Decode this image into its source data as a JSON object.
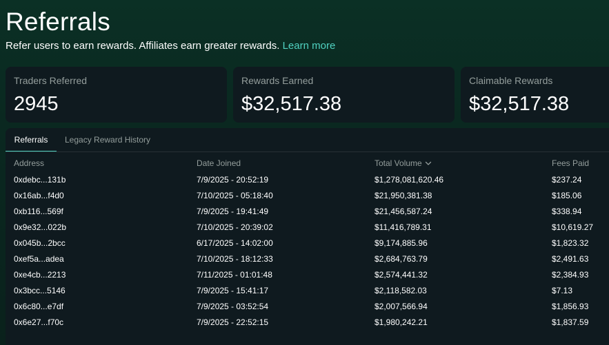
{
  "header": {
    "title": "Referrals",
    "subtitle": "Refer users to earn rewards. Affiliates earn greater rewards.",
    "learn_more": "Learn more"
  },
  "stats": [
    {
      "label": "Traders Referred",
      "value": "2945"
    },
    {
      "label": "Rewards Earned",
      "value": "$32,517.38"
    },
    {
      "label": "Claimable Rewards",
      "value": "$32,517.38"
    }
  ],
  "tabs": [
    {
      "label": "Referrals",
      "active": true
    },
    {
      "label": "Legacy Reward History",
      "active": false
    }
  ],
  "table": {
    "columns": [
      "Address",
      "Date Joined",
      "Total Volume",
      "Fees Paid"
    ],
    "sort_icon": "chevron-down-icon",
    "rows": [
      [
        "0xdebc...131b",
        "7/9/2025 - 20:52:19",
        "$1,278,081,620.46",
        "$237.24"
      ],
      [
        "0x16ab...f4d0",
        "7/10/2025 - 05:18:40",
        "$21,950,381.38",
        "$185.06"
      ],
      [
        "0xb116...569f",
        "7/9/2025 - 19:41:49",
        "$21,456,587.24",
        "$338.94"
      ],
      [
        "0x9e32...022b",
        "7/10/2025 - 20:39:02",
        "$11,416,789.31",
        "$10,619.27"
      ],
      [
        "0x045b...2bcc",
        "6/17/2025 - 14:02:00",
        "$9,174,885.96",
        "$1,823.32"
      ],
      [
        "0xef5a...adea",
        "7/10/2025 - 18:12:33",
        "$2,684,763.79",
        "$2,491.63"
      ],
      [
        "0xe4cb...2213",
        "7/11/2025 - 01:01:48",
        "$2,574,441.32",
        "$2,384.93"
      ],
      [
        "0x3bcc...5146",
        "7/9/2025 - 15:41:17",
        "$2,118,582.03",
        "$7.13"
      ],
      [
        "0x6c80...e7df",
        "7/9/2025 - 03:52:54",
        "$2,007,566.94",
        "$1,856.93"
      ],
      [
        "0x6e27...f70c",
        "7/9/2025 - 22:52:15",
        "$1,980,242.21",
        "$1,837.59"
      ]
    ]
  },
  "colors": {
    "accent": "#50d2c1",
    "card_background": "#0f1a1f",
    "muted_text": "#949e9c",
    "page_background": "#0a2820"
  }
}
